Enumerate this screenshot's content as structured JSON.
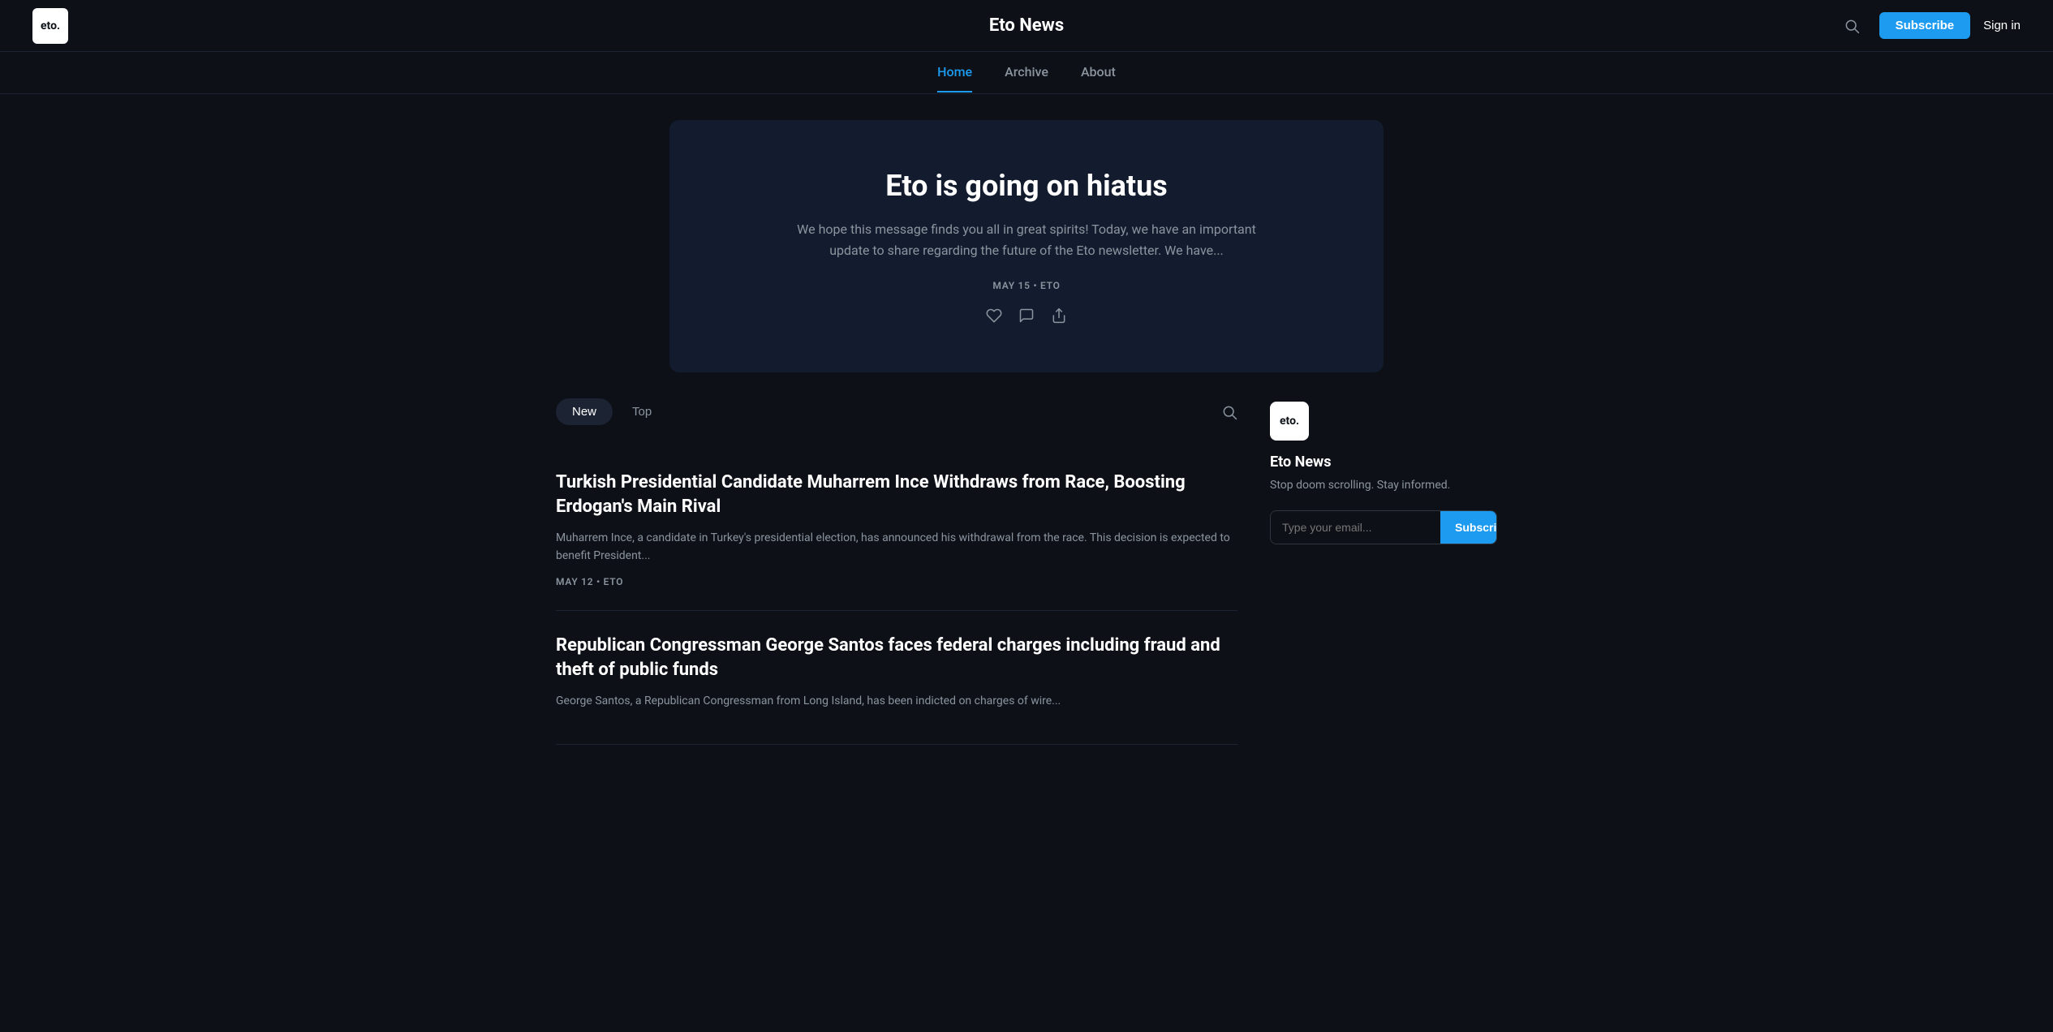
{
  "header": {
    "logo_text": "eto.",
    "site_title": "Eto News",
    "subscribe_label": "Subscribe",
    "sign_in_label": "Sign in"
  },
  "nav": {
    "items": [
      {
        "label": "Home",
        "active": true
      },
      {
        "label": "Archive",
        "active": false
      },
      {
        "label": "About",
        "active": false
      }
    ]
  },
  "hero": {
    "title": "Eto is going on hiatus",
    "subtitle": "We hope this message finds you all in great spirits! Today, we have an important update to share regarding the future of the Eto newsletter. We have...",
    "meta": "MAY 15 • ETO"
  },
  "posts_filter": {
    "new_label": "New",
    "top_label": "Top"
  },
  "posts": [
    {
      "title": "Turkish Presidential Candidate Muharrem Ince Withdraws from Race, Boosting Erdogan's Main Rival",
      "excerpt": "Muharrem Ince, a candidate in Turkey's presidential election, has announced his withdrawal from the race. This decision is expected to benefit President...",
      "meta": "MAY 12 • ETO"
    },
    {
      "title": "Republican Congressman George Santos faces federal charges including fraud and theft of public funds",
      "excerpt": "George Santos, a Republican Congressman from Long Island, has been indicted on charges of wire...",
      "meta": ""
    }
  ],
  "sidebar": {
    "logo_text": "eto.",
    "title": "Eto News",
    "description": "Stop doom scrolling. Stay informed.",
    "email_placeholder": "Type your email...",
    "subscribe_label": "Subscribe"
  },
  "colors": {
    "accent": "#1d9bf0",
    "bg_primary": "#0d1117",
    "bg_card": "#131c2e",
    "border": "#1c2333",
    "text_primary": "#ffffff",
    "text_secondary": "#8b949e"
  }
}
